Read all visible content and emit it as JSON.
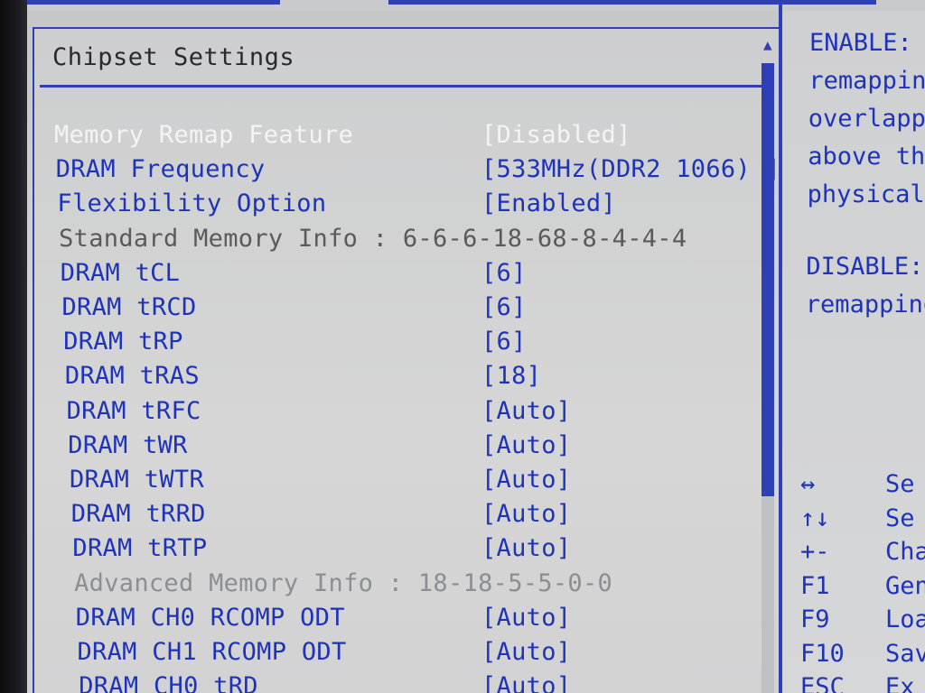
{
  "page": {
    "title": "Chipset Settings"
  },
  "settings": [
    {
      "label": "Memory Remap Feature",
      "value": "[Disabled]",
      "state": "selected"
    },
    {
      "label": "DRAM Frequency",
      "value": "[533MHz(DDR2 1066) ]",
      "state": "normal"
    },
    {
      "label": "Flexibility Option",
      "value": "[Enabled]",
      "state": "normal"
    },
    {
      "label": "Standard Memory Info : 6-6-6-18-68-8-4-4-4",
      "value": "",
      "state": "info"
    },
    {
      "label": "DRAM tCL",
      "value": "[6]",
      "state": "normal"
    },
    {
      "label": "DRAM tRCD",
      "value": "[6]",
      "state": "normal"
    },
    {
      "label": "DRAM tRP",
      "value": "[6]",
      "state": "normal"
    },
    {
      "label": "DRAM tRAS",
      "value": "[18]",
      "state": "normal"
    },
    {
      "label": "DRAM tRFC",
      "value": "[Auto]",
      "state": "normal"
    },
    {
      "label": "DRAM tWR",
      "value": "[Auto]",
      "state": "normal"
    },
    {
      "label": "DRAM tWTR",
      "value": "[Auto]",
      "state": "normal"
    },
    {
      "label": "DRAM tRRD",
      "value": "[Auto]",
      "state": "normal"
    },
    {
      "label": "DRAM tRTP",
      "value": "[Auto]",
      "state": "normal"
    },
    {
      "label": "Advanced Memory Info : 18-18-5-5-0-0",
      "value": "",
      "state": "info-faded"
    },
    {
      "label": "DRAM CH0 RCOMP ODT",
      "value": "[Auto]",
      "state": "normal"
    },
    {
      "label": "DRAM CH1 RCOMP ODT",
      "value": "[Auto]",
      "state": "normal"
    },
    {
      "label": "DRAM CH0 tRD",
      "value": "[Auto]",
      "state": "normal"
    }
  ],
  "help": {
    "lines": [
      "ENABLE:",
      "remappin",
      "overlapp",
      "above th",
      "physical",
      "",
      "DISABLE:",
      "remapping"
    ]
  },
  "keys": [
    {
      "key": "↔",
      "desc": "Se"
    },
    {
      "key": "↑↓",
      "desc": "Se"
    },
    {
      "key": "+-",
      "desc": "Cha"
    },
    {
      "key": "F1",
      "desc": "Gen"
    },
    {
      "key": "F9",
      "desc": "Loa"
    },
    {
      "key": "F10",
      "desc": "Sav"
    },
    {
      "key": "ESC",
      "desc": "Ex"
    }
  ],
  "scroll_arrow_icon": "triangle-up-icon",
  "colors": {
    "accent_blue": "#2f3fb4",
    "item_text": "#1f33b8",
    "selected_text": "#f4f4f4",
    "info_text": "#5a5a5a"
  }
}
